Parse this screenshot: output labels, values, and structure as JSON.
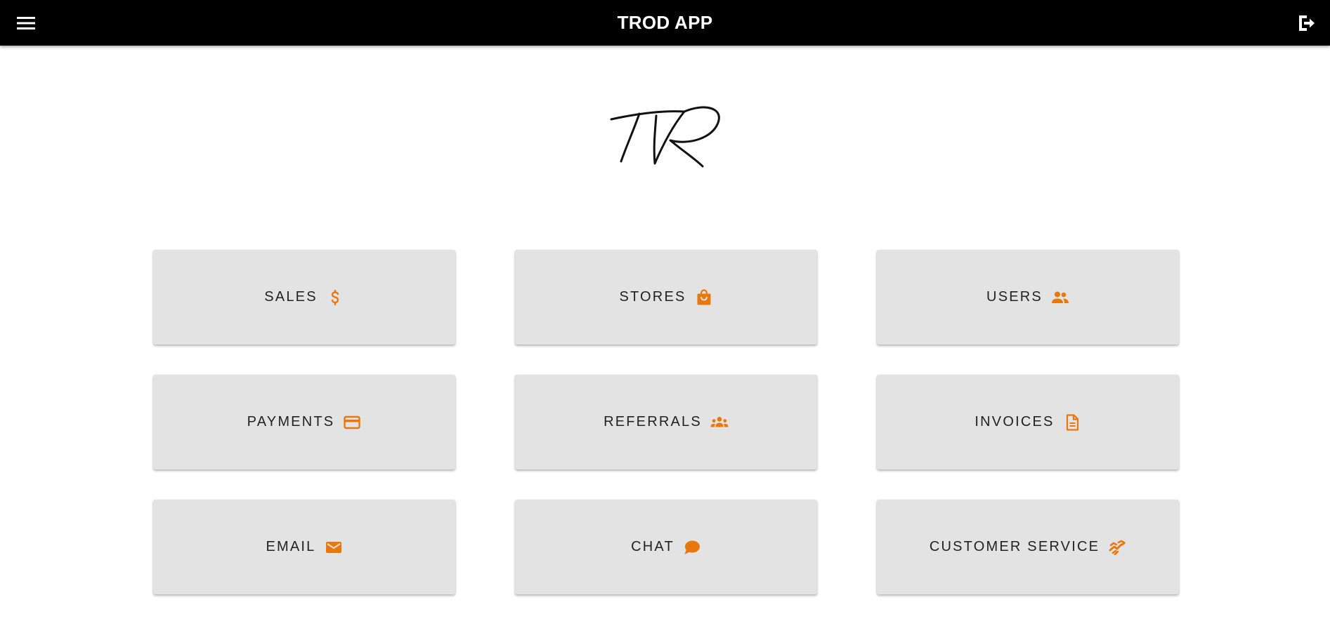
{
  "header": {
    "title": "TROD APP",
    "menu_icon": "hamburger-menu-icon",
    "logout_icon": "logout-icon"
  },
  "logo": {
    "text": "TR",
    "style": "handwritten signature"
  },
  "colors": {
    "header_bg": "#000000",
    "tile_bg": "#e3e3e3",
    "accent": "#e8780c",
    "tile_text": "#222222"
  },
  "tiles": [
    {
      "label": "SALES",
      "icon": "dollar-icon"
    },
    {
      "label": "STORES",
      "icon": "shopping-bag-icon"
    },
    {
      "label": "USERS",
      "icon": "users-icon"
    },
    {
      "label": "PAYMENTS",
      "icon": "credit-card-icon"
    },
    {
      "label": "REFERRALS",
      "icon": "group-icon"
    },
    {
      "label": "INVOICES",
      "icon": "document-icon"
    },
    {
      "label": "EMAIL",
      "icon": "envelope-icon"
    },
    {
      "label": "CHAT",
      "icon": "chat-bubble-icon"
    },
    {
      "label": "CUSTOMER SERVICE",
      "icon": "handshake-icon"
    }
  ]
}
